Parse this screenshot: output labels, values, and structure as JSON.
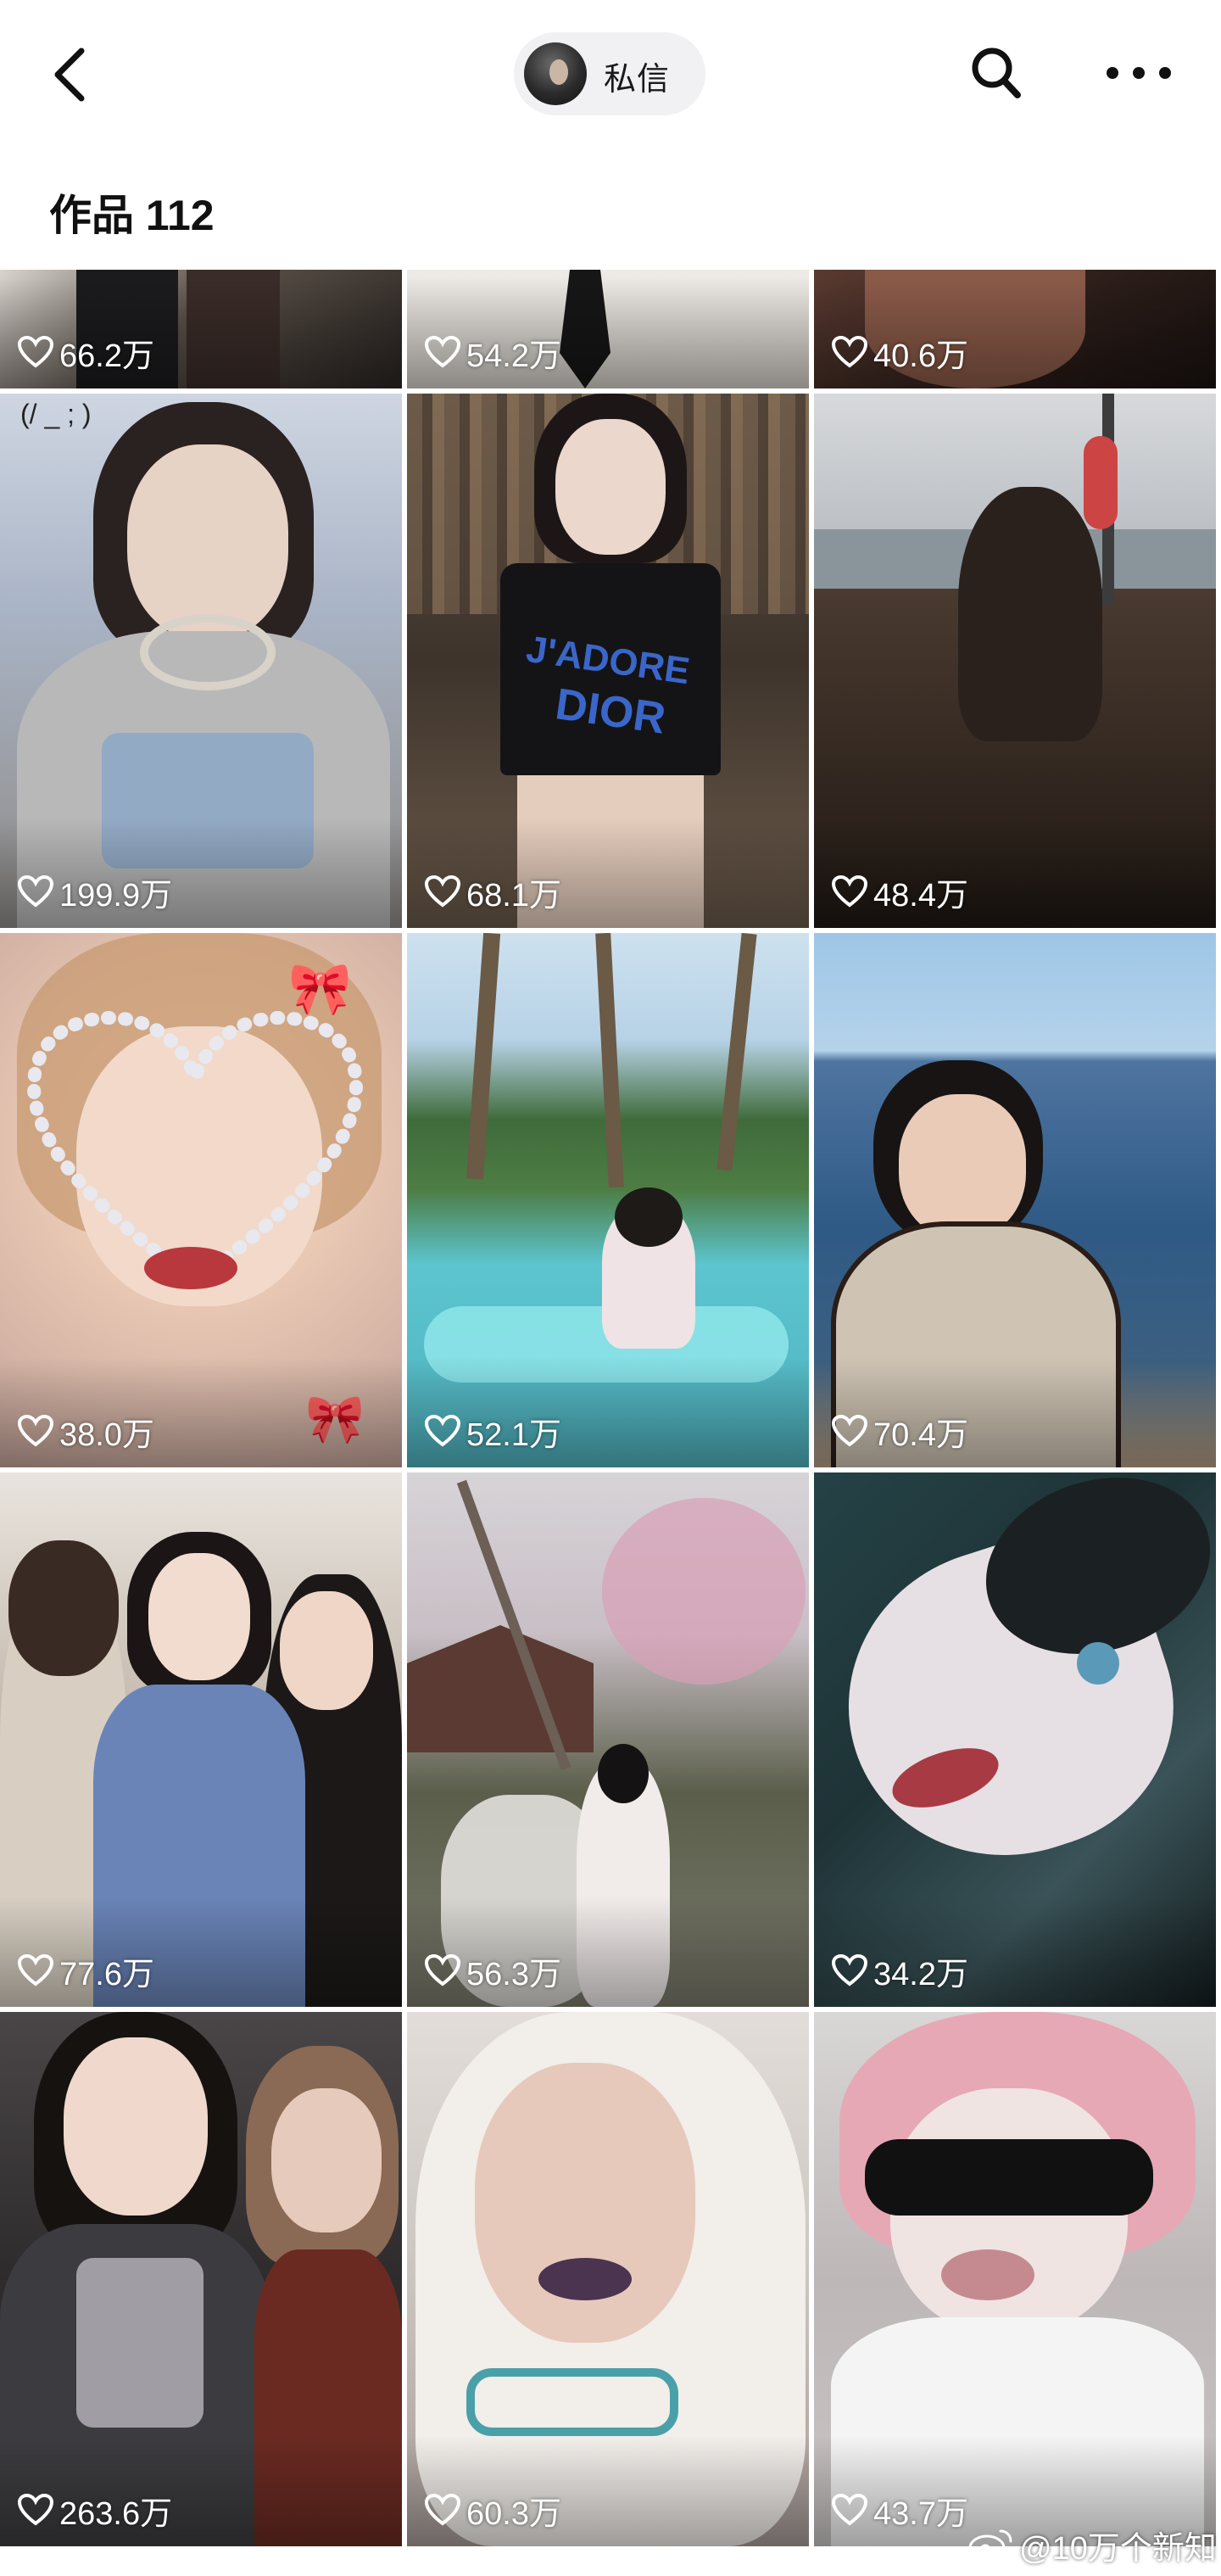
{
  "header": {
    "back_icon": "chevron-left-icon",
    "dm_label": "私信",
    "search_icon": "search-icon",
    "more_icon": "more-horizontal-icon"
  },
  "works": {
    "title": "作品 112"
  },
  "grid": {
    "items": [
      {
        "likes": "66.2万"
      },
      {
        "likes": "54.2万"
      },
      {
        "likes": "40.6万"
      },
      {
        "likes": "199.9万"
      },
      {
        "likes": "68.1万"
      },
      {
        "likes": "48.4万"
      },
      {
        "likes": "38.0万"
      },
      {
        "likes": "52.1万"
      },
      {
        "likes": "70.4万"
      },
      {
        "likes": "77.6万"
      },
      {
        "likes": "56.3万"
      },
      {
        "likes": "34.2万"
      },
      {
        "likes": "263.6万"
      },
      {
        "likes": "60.3万"
      },
      {
        "likes": "43.7万"
      }
    ],
    "tile2_shirt_text_1": "J'ADORE",
    "tile2_shirt_text_2": "DIOR",
    "tile1_face_text": "(/ _ ; )"
  },
  "watermark": {
    "text": "@10万个新知",
    "icon": "weibo-icon"
  },
  "colors": {
    "text_primary": "#111111",
    "pill_bg": "#f1f1f3",
    "like_text": "#ffffff"
  }
}
